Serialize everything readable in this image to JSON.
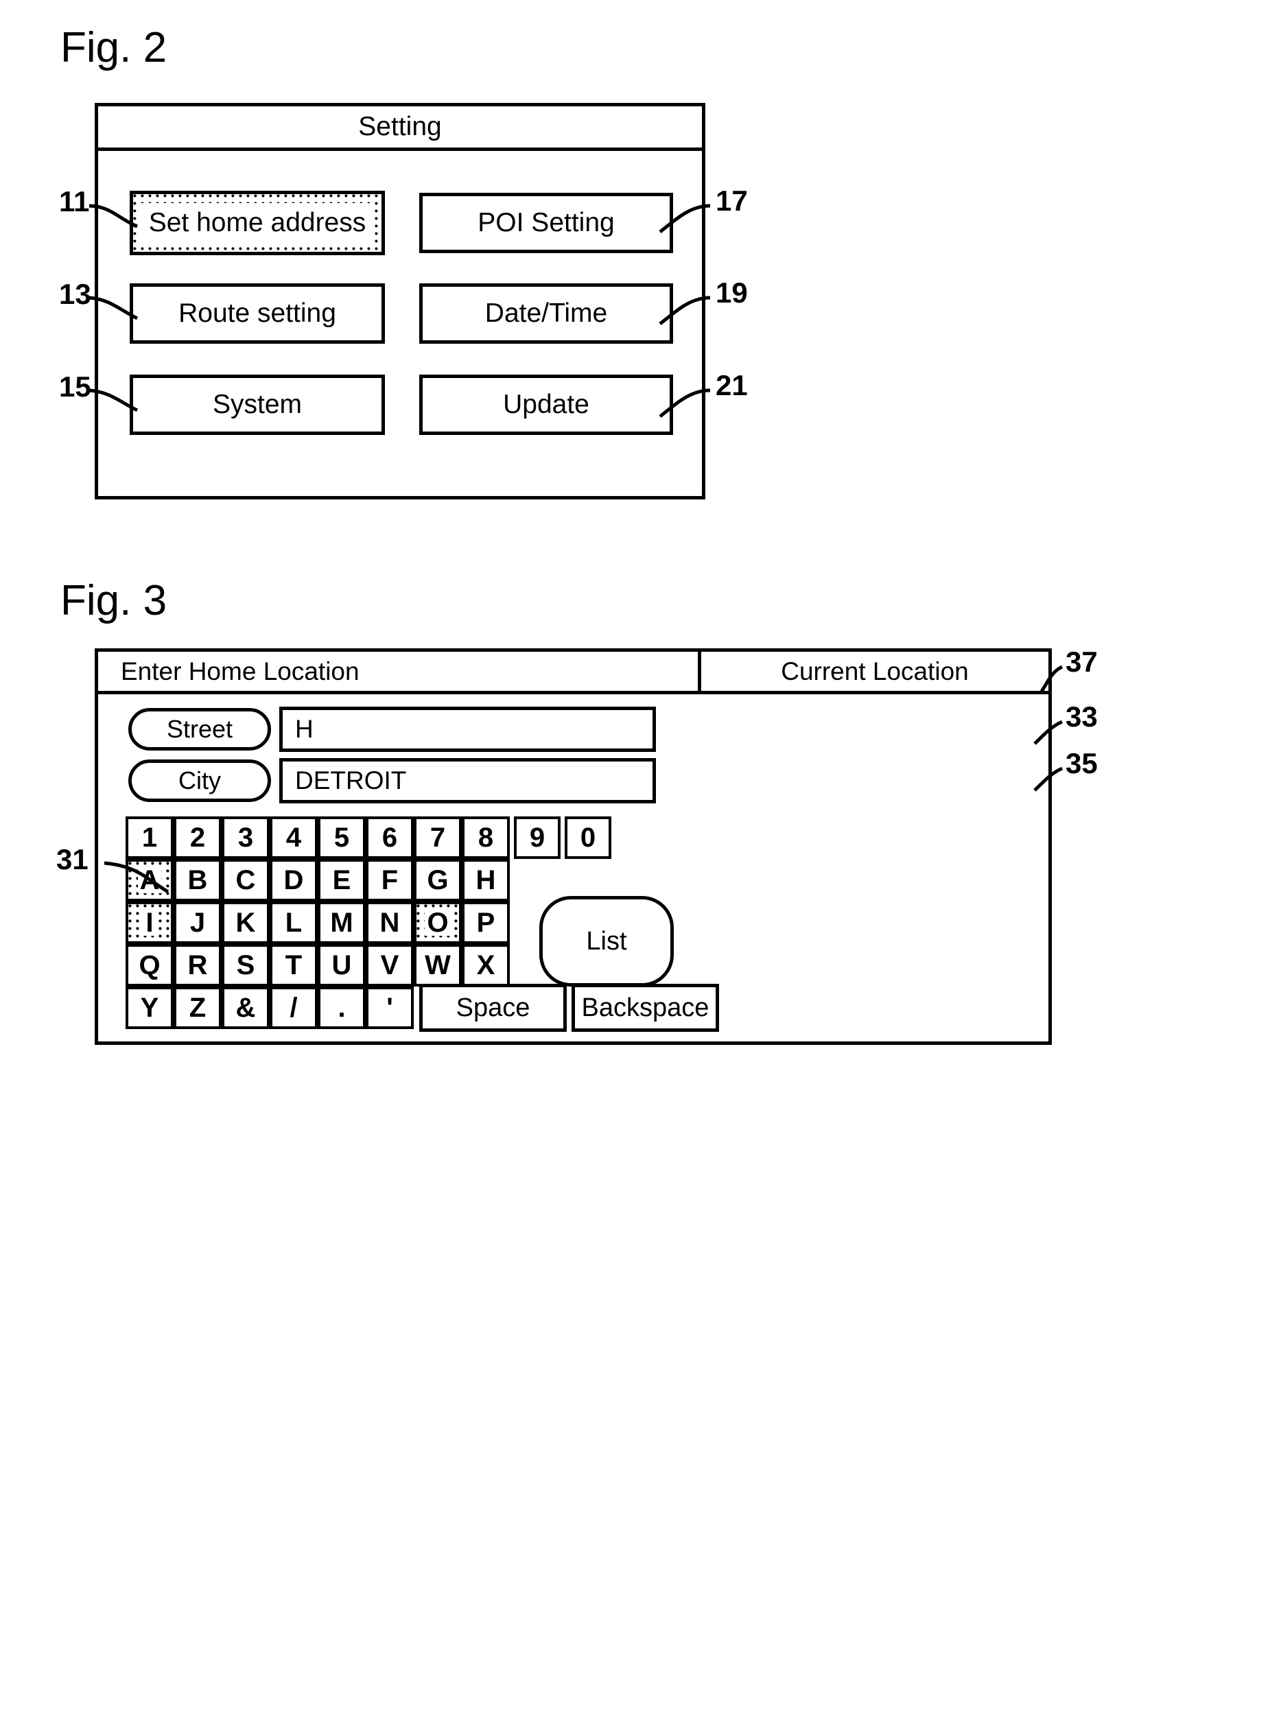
{
  "figures": [
    {
      "caption": "Fig. 2",
      "screen": {
        "title": "Setting",
        "buttons": [
          {
            "label": "Set home address",
            "ref": "11",
            "selected": true,
            "col": "left",
            "row": 0
          },
          {
            "label": "Route setting",
            "ref": "13",
            "selected": false,
            "col": "left",
            "row": 1
          },
          {
            "label": "System",
            "ref": "15",
            "selected": false,
            "col": "left",
            "row": 2
          },
          {
            "label": "POI Setting",
            "ref": "17",
            "selected": false,
            "col": "right",
            "row": 0
          },
          {
            "label": "Date/Time",
            "ref": "19",
            "selected": false,
            "col": "right",
            "row": 1
          },
          {
            "label": "Update",
            "ref": "21",
            "selected": false,
            "col": "right",
            "row": 2
          }
        ]
      }
    },
    {
      "caption": "Fig. 3",
      "screen": {
        "header_title": "Enter Home Location",
        "current_location_label": "Current Location",
        "current_location_ref": "37",
        "fields": [
          {
            "pill_label": "Street",
            "value": "H",
            "ref": "33"
          },
          {
            "pill_label": "City",
            "value": "DETROIT",
            "ref": "35"
          }
        ],
        "keyboard_ref": "31",
        "keyboard_rows": [
          {
            "keys": [
              {
                "label": "1",
                "dim": false
              },
              {
                "label": "2",
                "dim": false
              },
              {
                "label": "3",
                "dim": false
              },
              {
                "label": "4",
                "dim": false
              },
              {
                "label": "5",
                "dim": false
              },
              {
                "label": "6",
                "dim": false
              },
              {
                "label": "7",
                "dim": false
              },
              {
                "label": "8",
                "dim": false
              },
              {
                "label": "9",
                "dim": false,
                "detached": true
              },
              {
                "label": "0",
                "dim": false,
                "detached": true
              }
            ]
          },
          {
            "keys": [
              {
                "label": "A",
                "dim": true
              },
              {
                "label": "B",
                "dim": false
              },
              {
                "label": "C",
                "dim": false
              },
              {
                "label": "D",
                "dim": false
              },
              {
                "label": "E",
                "dim": false
              },
              {
                "label": "F",
                "dim": false
              },
              {
                "label": "G",
                "dim": false
              },
              {
                "label": "H",
                "dim": false
              }
            ]
          },
          {
            "keys": [
              {
                "label": "I",
                "dim": true
              },
              {
                "label": "J",
                "dim": false
              },
              {
                "label": "K",
                "dim": false
              },
              {
                "label": "L",
                "dim": false
              },
              {
                "label": "M",
                "dim": false
              },
              {
                "label": "N",
                "dim": false
              },
              {
                "label": "O",
                "dim": true
              },
              {
                "label": "P",
                "dim": false
              }
            ]
          },
          {
            "keys": [
              {
                "label": "Q",
                "dim": false
              },
              {
                "label": "R",
                "dim": false
              },
              {
                "label": "S",
                "dim": false
              },
              {
                "label": "T",
                "dim": false
              },
              {
                "label": "U",
                "dim": false
              },
              {
                "label": "V",
                "dim": false
              },
              {
                "label": "W",
                "dim": false
              },
              {
                "label": "X",
                "dim": false
              }
            ]
          },
          {
            "keys": [
              {
                "label": "Y",
                "dim": false
              },
              {
                "label": "Z",
                "dim": false
              },
              {
                "label": "&",
                "dim": false
              },
              {
                "label": "/",
                "dim": false
              },
              {
                "label": ".",
                "dim": false
              },
              {
                "label": "'",
                "dim": false
              }
            ]
          }
        ],
        "list_label": "List",
        "space_label": "Space",
        "backspace_label": "Backspace"
      }
    }
  ]
}
